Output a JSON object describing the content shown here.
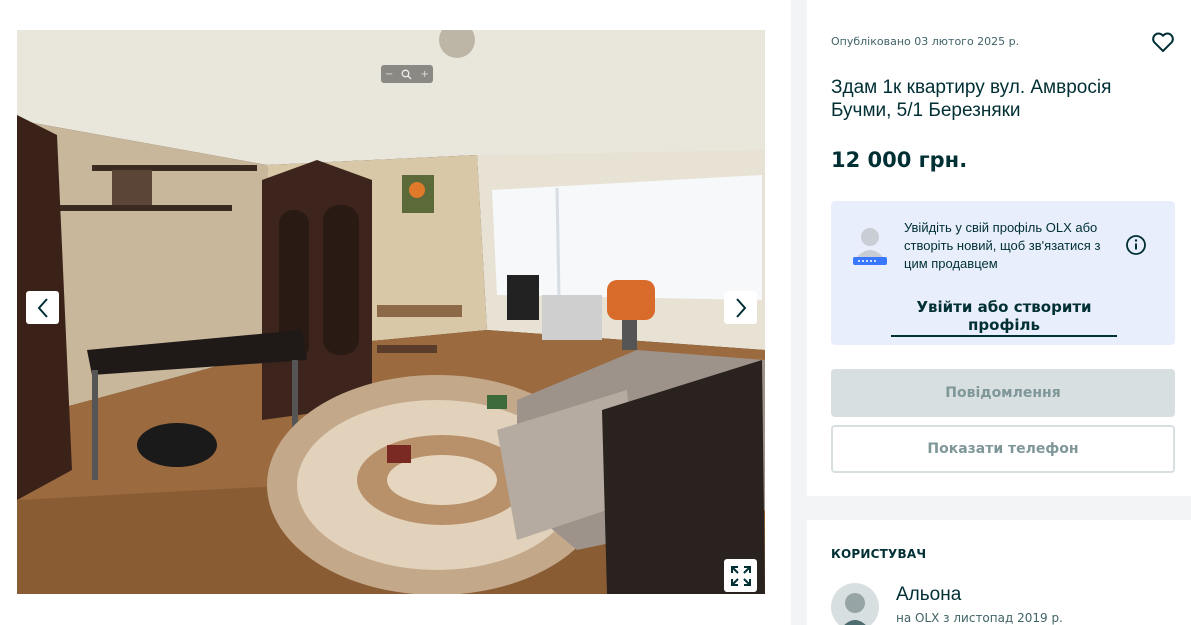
{
  "gallery": {
    "zoom_minus": "−",
    "zoom_plus": "+",
    "prev_icon": "chevron-left-icon",
    "next_icon": "chevron-right-icon",
    "fullscreen_icon": "fullscreen-icon"
  },
  "listing": {
    "posted": "Опубліковано 03 лютого 2025 р.",
    "title": "Здам 1к квартиру вул. Амвросія Бучми, 5/1 Березняки",
    "price": "12 000 грн."
  },
  "login_prompt": {
    "text": "Увійдіть у свій профіль OLX або створіть новий, щоб зв'язатися з цим продавцем",
    "link": "Увійти або створити профіль"
  },
  "actions": {
    "message": "Повідомлення",
    "phone": "Показати телефон"
  },
  "user": {
    "heading": "КОРИСТУВАЧ",
    "name": "Альона",
    "since": "на OLX з листопад 2019 р."
  },
  "colors": {
    "brand_dark": "#002f34",
    "login_bg": "#e8eefb",
    "button_disabled": "#d8dfe0",
    "page_bg": "#f2f4f5"
  }
}
